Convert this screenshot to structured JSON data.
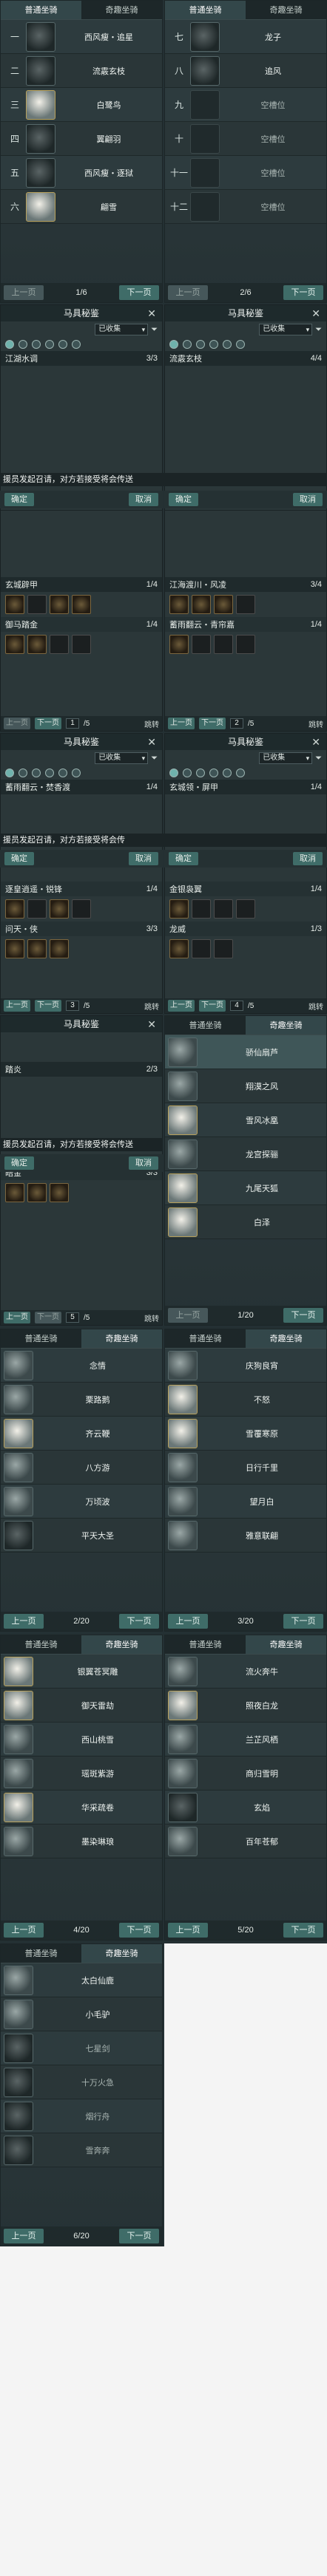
{
  "tabs": {
    "common": "普通坐骑",
    "special": "奇趣坐骑"
  },
  "buttons": {
    "prev": "上一页",
    "next": "下一页",
    "confirm": "确定",
    "cancel": "取消",
    "jump": "跳转"
  },
  "summon_text": "援员发起召请，对方若接受将会传送",
  "summon_text2": "援员发起召请，对方若接受将会传",
  "stable_left": {
    "page": "1/6",
    "slots": [
      {
        "num": "一",
        "name": "西风瘦・追星"
      },
      {
        "num": "二",
        "name": "流霰玄枝"
      },
      {
        "num": "三",
        "name": "白鹭鸟"
      },
      {
        "num": "四",
        "name": "翼翩羽"
      },
      {
        "num": "五",
        "name": "西风瘦・逐狱"
      },
      {
        "num": "六",
        "name": "翩雪"
      }
    ]
  },
  "stable_right": {
    "page": "2/6",
    "slots": [
      {
        "num": "七",
        "name": "龙子"
      },
      {
        "num": "八",
        "name": "追风"
      },
      {
        "num": "九",
        "name": "空槽位"
      },
      {
        "num": "十",
        "name": "空槽位"
      },
      {
        "num": "十一",
        "name": "空槽位"
      },
      {
        "num": "十二",
        "name": "空槽位"
      }
    ]
  },
  "mj": {
    "title": "马具秘鉴",
    "filter_value": "已收集",
    "a": {
      "sets": [
        [
          "江湖水调",
          "3/3"
        ]
      ],
      "page": "1"
    },
    "b": {
      "sets": [
        [
          "流霰玄枝",
          "4/4"
        ]
      ],
      "page": "1"
    },
    "c": {
      "sets": [
        [
          "玄城辟甲",
          "1/4"
        ],
        [
          "御马踏金",
          "1/4"
        ]
      ],
      "page": "1",
      "total": "/5"
    },
    "d": {
      "sets": [
        [
          "江海渡川・风凌",
          "3/4"
        ],
        [
          "蓄雨翻云・青帘嘉",
          "1/4"
        ]
      ],
      "page": "2",
      "total": "/5"
    },
    "e": {
      "sets": [
        [
          "蓄雨翻云・焚香渡",
          "1/4"
        ],
        [
          "逐皇逍遥・锐锋",
          "1/4"
        ],
        [
          "问天・侠",
          "3/3"
        ]
      ],
      "page": "3",
      "total": "/5"
    },
    "f": {
      "sets": [
        [
          "玄城领・屏甲",
          "1/4"
        ],
        [
          "金银袅翼",
          "1/4"
        ],
        [
          "龙威",
          "1/3"
        ]
      ],
      "page": "4",
      "total": "/5"
    },
    "g": {
      "sets": [
        [
          "踏炎",
          "2/3"
        ],
        [
          "皓金",
          "3/3"
        ]
      ],
      "page": "5",
      "total": "/5"
    }
  },
  "special_pages": [
    {
      "page": "1/20",
      "items": [
        "骄仙扇芦",
        "翔漠之风",
        "雪风冰凰",
        "龙宫探骊",
        "九尾天狐",
        "白泽"
      ]
    },
    {
      "page": "2/20",
      "items": [
        "念情",
        "栗路鹅",
        "齐云鞭",
        "八方游",
        "万顷波",
        "平天大圣"
      ]
    },
    {
      "page": "3/20",
      "items": [
        "庆狗良宵",
        "不怒",
        "雪覆寒原",
        "日行千里",
        "望月白",
        "雅意联翩"
      ]
    },
    {
      "page": "4/20",
      "items": [
        "银翼苍冥雕",
        "御天雷劫",
        "西山桃雪",
        "瑶斑紫游",
        "华采疏卷",
        "墨染琳琅"
      ]
    },
    {
      "page": "5/20",
      "items": [
        "流火奔牛",
        "照夜白龙",
        "兰芷风栖",
        "商归雪明",
        "玄焰",
        "百年苍郁"
      ]
    },
    {
      "page": "6/20",
      "items": [
        "太白仙鹿",
        "小毛驴",
        "七星剑",
        "十万火急",
        "烟行舟",
        "雪奔奔"
      ]
    }
  ]
}
